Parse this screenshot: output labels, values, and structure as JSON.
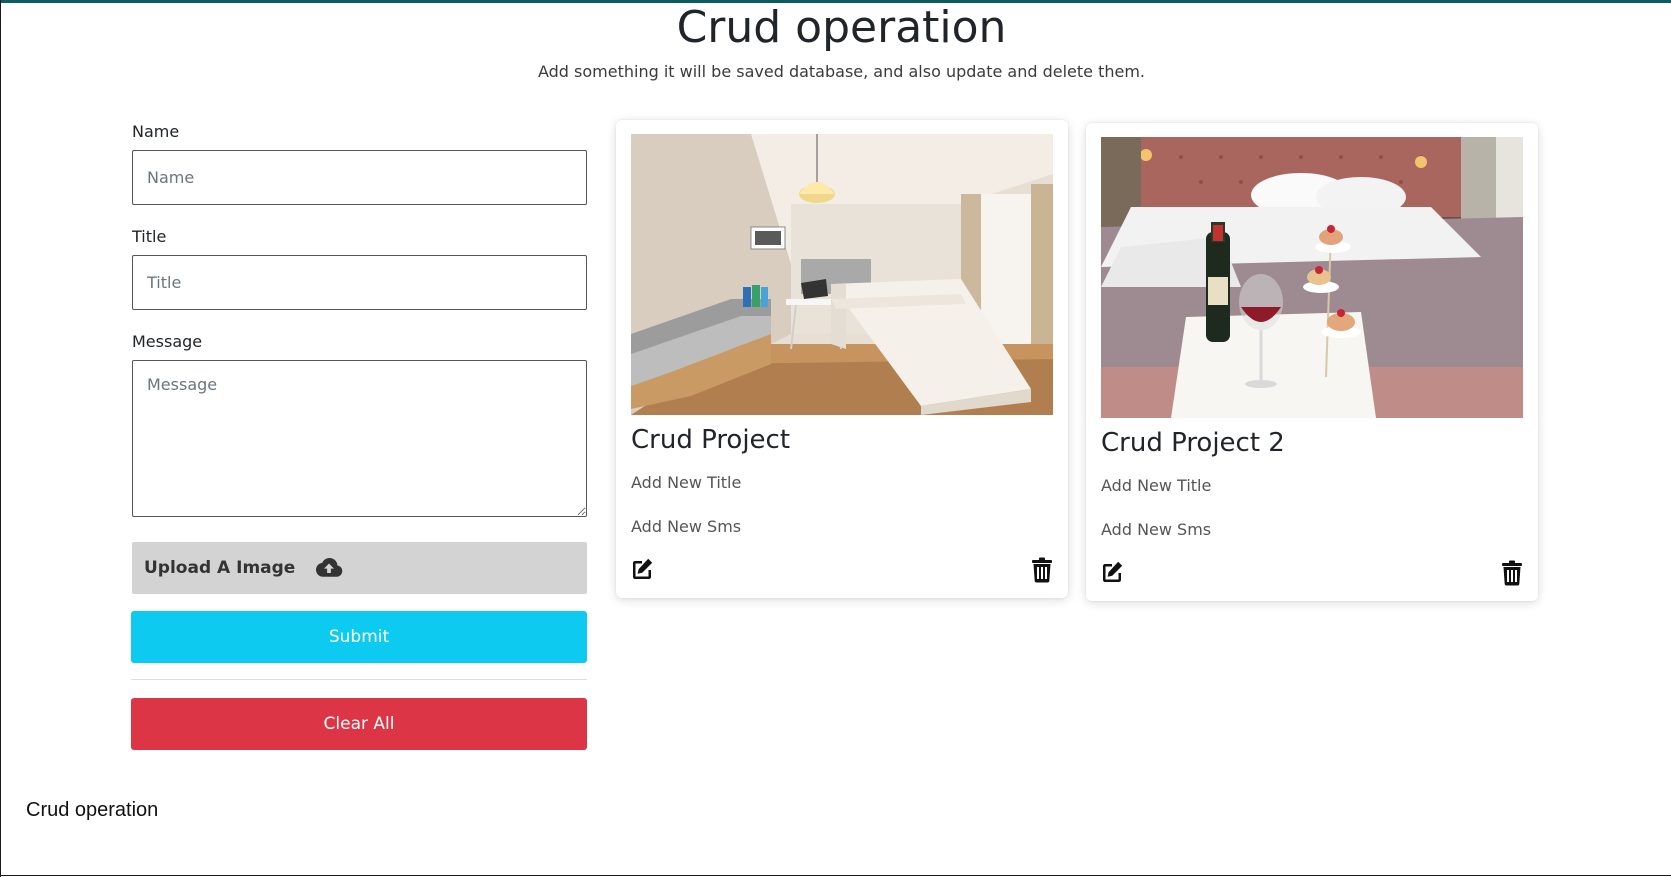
{
  "header": {
    "title": "Crud operation",
    "subtitle": "Add something it will be saved database, and also update and delete them."
  },
  "form": {
    "name": {
      "label": "Name",
      "placeholder": "Name",
      "value": ""
    },
    "title": {
      "label": "Title",
      "placeholder": "Title",
      "value": ""
    },
    "message": {
      "label": "Message",
      "placeholder": "Message",
      "value": ""
    },
    "upload": {
      "label": "Upload A Image",
      "icon": "cloud-upload-icon"
    },
    "submit_label": "Submit",
    "clear_label": "Clear All"
  },
  "cards": [
    {
      "title": "Crud Project",
      "text_title": "Add New Title",
      "text_sms": "Add New Sms",
      "image": "hotel-room-photo",
      "edit_icon": "edit-icon",
      "delete_icon": "trash-icon"
    },
    {
      "title": "Crud Project 2",
      "text_title": "Add New Title",
      "text_sms": "Add New Sms",
      "image": "bedroom-champagne-photo",
      "edit_icon": "edit-icon",
      "delete_icon": "trash-icon"
    }
  ],
  "footer": {
    "text": "Crud operation"
  },
  "colors": {
    "top_bar": "#0d5c63",
    "submit": "#0dcaf0",
    "clear": "#dc3545",
    "upload_bg": "#d3d3d3"
  }
}
